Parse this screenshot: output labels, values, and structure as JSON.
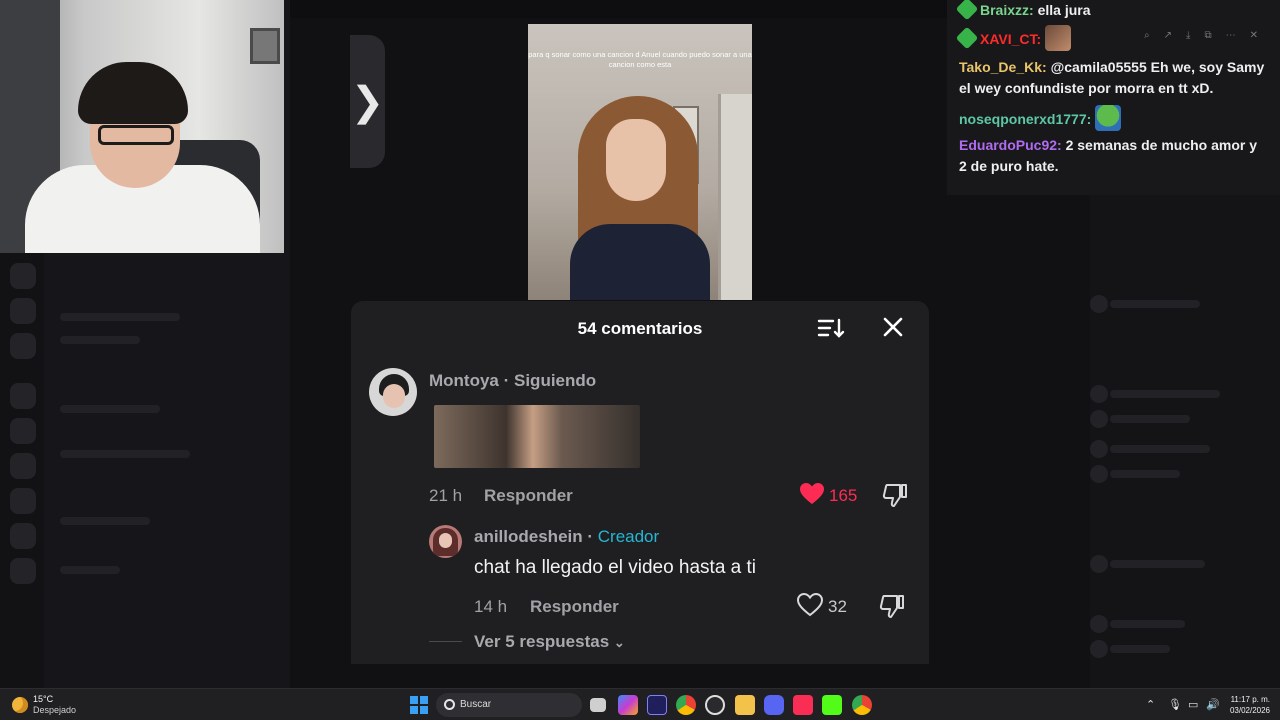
{
  "video": {
    "caption": "para q sonar como una cancion d Anuel cuando puedo sonar a una cancion como esta",
    "next_arrow": "❯"
  },
  "chat": {
    "messages": [
      {
        "user": "Braixzz:",
        "user_color": "#7bd48d",
        "text": "ella jura",
        "badge": true,
        "emote": false
      },
      {
        "user": "XAVI_CT:",
        "user_color": "#ff2a2a",
        "text": "",
        "badge": true,
        "emote": true
      },
      {
        "user": "Tako_De_Kk:",
        "user_color": "#e8c46a",
        "text": "@camila05555 Eh we, soy Samy el wey confundiste por morra en tt xD.",
        "badge": false,
        "emote": false
      },
      {
        "user": "noseqponerxd1777:",
        "user_color": "#5ec7a3",
        "text": "",
        "badge": false,
        "emote": true
      },
      {
        "user": "EduardoPuc92:",
        "user_color": "#b06cf0",
        "text": "2 semanas de mucho amor y 2 de puro hate.",
        "badge": false,
        "emote": false
      }
    ]
  },
  "comments": {
    "title": "54 comentarios",
    "c1": {
      "user": "Montoya · Siguiendo",
      "time": "21 h",
      "reply": "Responder",
      "likes": "165",
      "liked": true
    },
    "c2": {
      "user": "anillodeshein",
      "creator_tag": "Creador",
      "text": "chat ha llegado el video hasta a ti",
      "time": "14 h",
      "reply": "Responder",
      "likes": "32",
      "liked": false
    },
    "view_replies": "Ver 5 respuestas"
  },
  "taskbar": {
    "temp": "15°C",
    "weather": "Despejado",
    "search_placeholder": "Buscar",
    "time": "11:17 p. m.",
    "date": "03/02/2026"
  },
  "colors": {
    "accent_like": "#fe2c55",
    "creator": "#25b6d4"
  }
}
